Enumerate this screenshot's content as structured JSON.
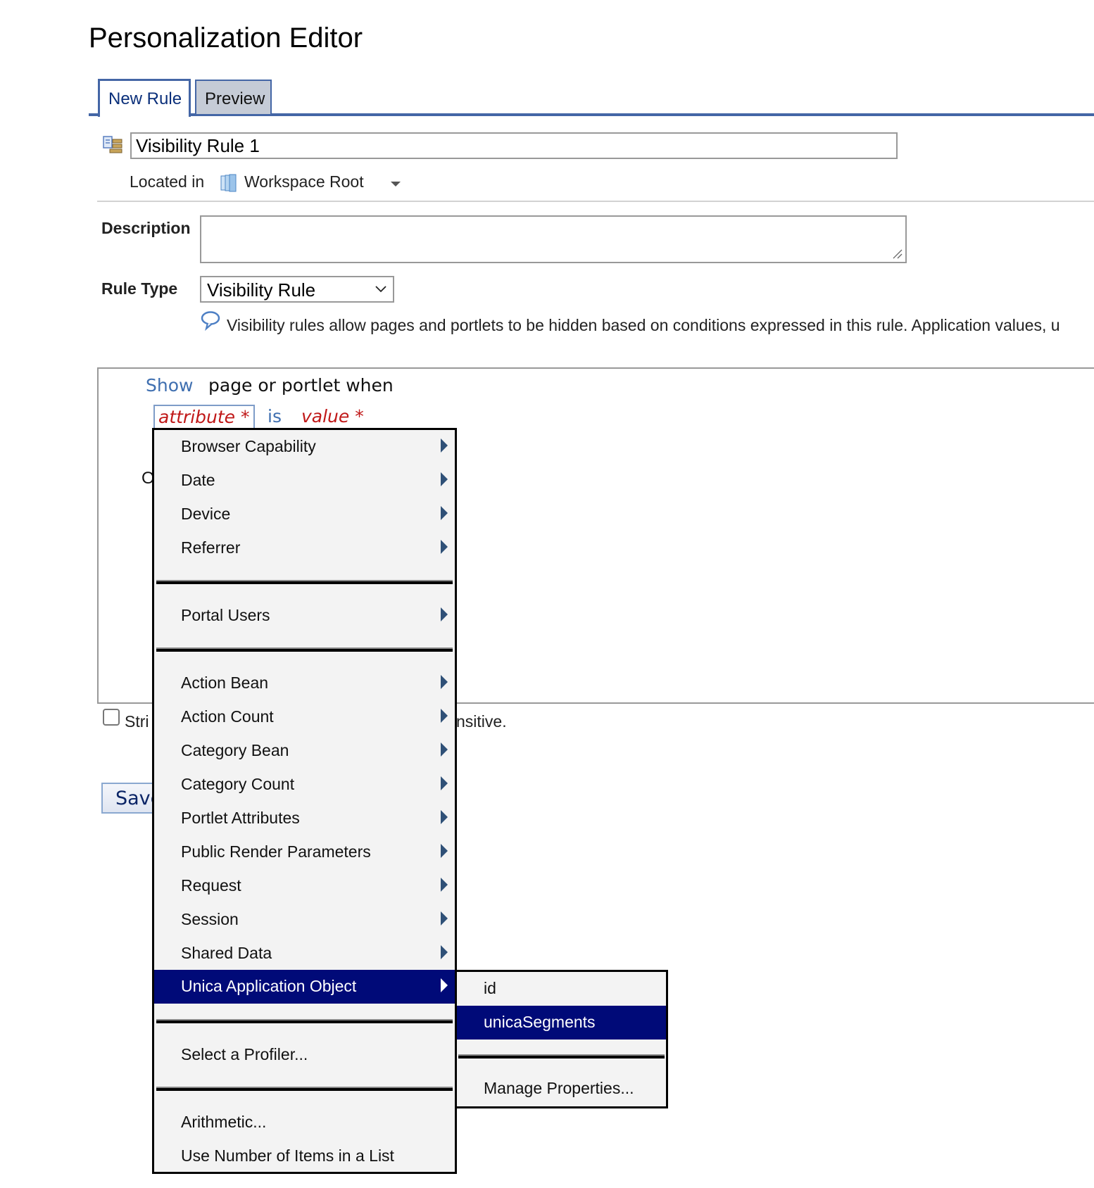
{
  "page": {
    "title": "Personalization Editor"
  },
  "tabs": [
    {
      "label": "New Rule",
      "active": true
    },
    {
      "label": "Preview",
      "active": false
    }
  ],
  "rule": {
    "name": "Visibility Rule 1",
    "located_label": "Located in",
    "location": "Workspace Root",
    "description_label": "Description",
    "description_value": "",
    "rule_type_label": "Rule Type",
    "rule_type_value": "Visibility Rule",
    "help_text": "Visibility rules allow pages and portlets to be hidden based on conditions expressed in this rule. Application values, u"
  },
  "editor": {
    "show": "Show",
    "when_text": "page or portlet when",
    "attribute": "attribute *",
    "is": "is",
    "value": "value *",
    "hidden_fragment": "O",
    "strict_label_visible_start": "Stri",
    "strict_label_visible_end": "nsitive.",
    "strict_checked": false,
    "save_label": "Save"
  },
  "context_menu": {
    "groups": [
      [
        "Browser Capability",
        "Date",
        "Device",
        "Referrer"
      ],
      [
        "Portal Users"
      ],
      [
        "Action Bean",
        "Action Count",
        "Category Bean",
        "Category Count",
        "Portlet Attributes",
        "Public Render Parameters",
        "Request",
        "Session",
        "Shared Data",
        "Unica Application Object"
      ],
      [
        "Select a Profiler..."
      ],
      [
        "Arithmetic...",
        "Use Number of Items in a List"
      ]
    ],
    "items": {
      "browser_capability": "Browser Capability",
      "date": "Date",
      "device": "Device",
      "referrer": "Referrer",
      "portal_users": "Portal Users",
      "action_bean": "Action Bean",
      "action_count": "Action Count",
      "category_bean": "Category Bean",
      "category_count": "Category Count",
      "portlet_attributes": "Portlet Attributes",
      "public_render_parameters": "Public Render Parameters",
      "request": "Request",
      "session": "Session",
      "shared_data": "Shared Data",
      "unica_application_object": "Unica Application Object",
      "select_profiler": "Select a Profiler...",
      "arithmetic": "Arithmetic...",
      "use_number_of_items": "Use Number of Items in a List"
    },
    "active_item": "Unica Application Object"
  },
  "submenu": {
    "items": {
      "id": "id",
      "unica_segments": "unicaSegments",
      "manage_properties": "Manage Properties..."
    },
    "active_item": "unicaSegments"
  },
  "colors": {
    "tab_border": "#4466a6",
    "highlight": "#000a78",
    "attribute_red": "#c01818",
    "keyword_blue": "#3f6fb0"
  }
}
